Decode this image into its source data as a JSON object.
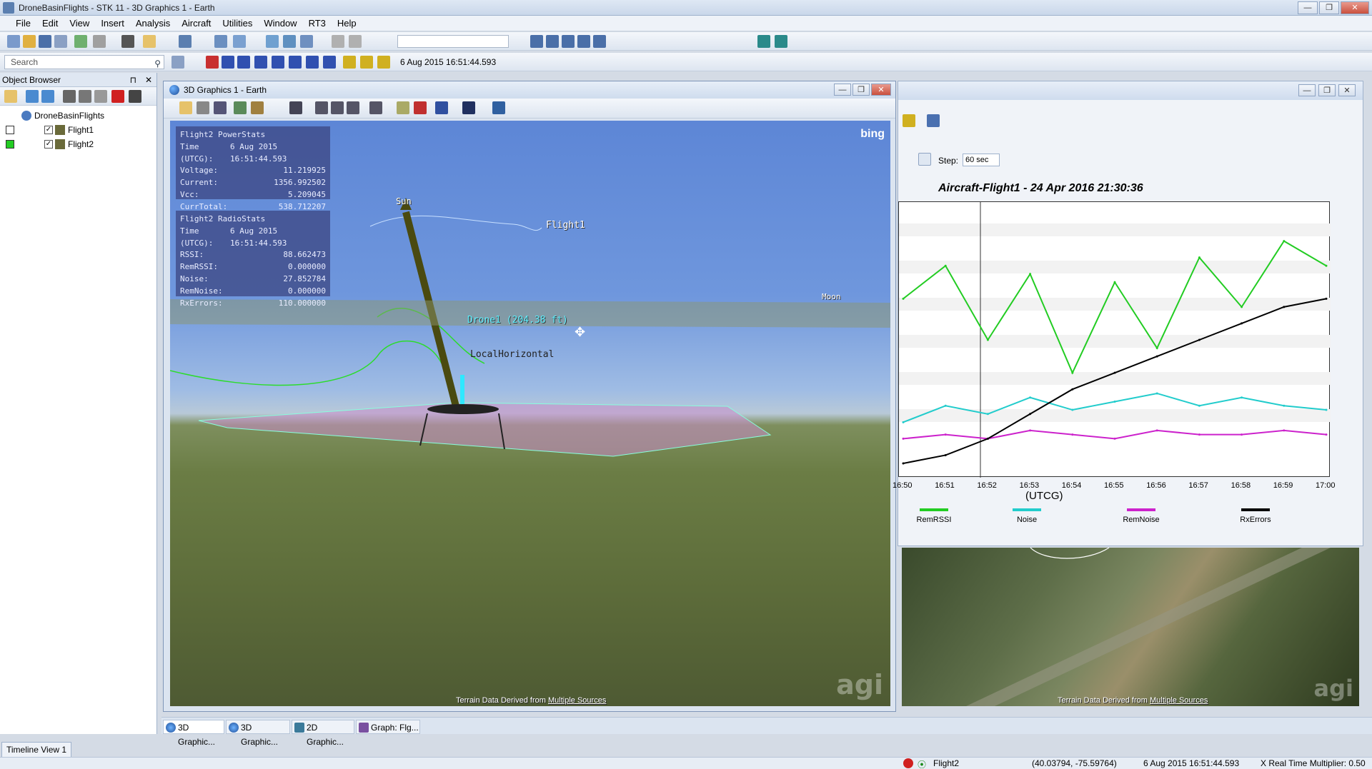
{
  "window": {
    "title": "DroneBasinFlights - STK 11 - 3D Graphics 1 - Earth",
    "minimize": "—",
    "maximize": "❐",
    "close": "✕"
  },
  "menu": [
    "File",
    "Edit",
    "View",
    "Insert",
    "Analysis",
    "Aircraft",
    "Utilities",
    "Window",
    "RT3",
    "Help"
  ],
  "toolbar": {
    "search_placeholder": "Search",
    "current_time": "6 Aug 2015 16:51:44.593"
  },
  "object_browser": {
    "title": "Object Browser",
    "pin": "⊓",
    "close": "✕",
    "root": "DroneBasinFlights",
    "items": [
      {
        "label": "Flight1",
        "color": "#ffffff"
      },
      {
        "label": "Flight2",
        "color": "#22cc22"
      }
    ]
  },
  "view3d": {
    "title": "3D Graphics 1 - Earth",
    "bing": "bing",
    "agi": "agi",
    "terrain_note_prefix": "Terrain Data Derived from ",
    "terrain_note_link": "Multiple Sources",
    "power_stats": {
      "header": "Flight2 PowerStats",
      "rows": [
        {
          "k": "Time (UTCG):",
          "v": "6 Aug 2015 16:51:44.593"
        },
        {
          "k": "Voltage:",
          "v": "11.219925"
        },
        {
          "k": "Current:",
          "v": "1356.992502"
        },
        {
          "k": "Vcc:",
          "v": "5.209045"
        },
        {
          "k": "CurrTotal:",
          "v": "538.712207"
        }
      ]
    },
    "radio_stats": {
      "header": "Flight2 RadioStats",
      "rows": [
        {
          "k": "Time (UTCG):",
          "v": "6 Aug 2015 16:51:44.593"
        },
        {
          "k": "RSSI:",
          "v": "88.662473"
        },
        {
          "k": "RemRSSI:",
          "v": "0.000000"
        },
        {
          "k": "Noise:",
          "v": "27.852784"
        },
        {
          "k": "RemNoise:",
          "v": "0.000000"
        },
        {
          "k": "RxErrors:",
          "v": "110.000000"
        }
      ]
    },
    "labels": {
      "sun": "Sun",
      "flight1": "Flight1",
      "moon": "Moon",
      "drone": "Drone1 (204.38 ft)",
      "horizontal": "LocalHorizontal"
    }
  },
  "graph": {
    "title": "Aircraft-Flight1 - 24 Apr 2016 21:30:36",
    "step_label": "Step:",
    "step_value": "60 sec",
    "xlabel": "(UTCG)",
    "chart_data": {
      "type": "line",
      "categories": [
        "16:50",
        "16:51",
        "16:52",
        "16:53",
        "16:54",
        "16:55",
        "16:56",
        "16:57",
        "16:58",
        "16:59",
        "17:00"
      ],
      "series": [
        {
          "name": "RemRSSI",
          "color": "#22cc22",
          "values": [
            40,
            48,
            30,
            46,
            22,
            44,
            28,
            50,
            38,
            54,
            48
          ]
        },
        {
          "name": "Noise",
          "color": "#22cccc",
          "values": [
            10,
            14,
            12,
            16,
            13,
            15,
            17,
            14,
            16,
            14,
            13
          ]
        },
        {
          "name": "RemNoise",
          "color": "#cc22cc",
          "values": [
            6,
            7,
            6,
            8,
            7,
            6,
            8,
            7,
            7,
            8,
            7
          ]
        },
        {
          "name": "RxErrors",
          "color": "#000000",
          "values": [
            0,
            2,
            6,
            12,
            18,
            22,
            26,
            30,
            34,
            38,
            40
          ]
        }
      ]
    }
  },
  "view3d2": {
    "agi": "agi",
    "terrain_note_prefix": "Terrain Data Derived from ",
    "terrain_note_link": "Multiple Sources"
  },
  "tabs": [
    "3D Graphic...",
    "3D Graphic...",
    "2D Graphic...",
    "Graph: Flg..."
  ],
  "timeline_tab": "Timeline View 1",
  "status": {
    "object": "Flight2",
    "coords": "(40.03794, -75.59764)",
    "time": "6 Aug 2015 16:51:44.593",
    "multiplier": "X Real Time Multiplier: 0.50"
  }
}
